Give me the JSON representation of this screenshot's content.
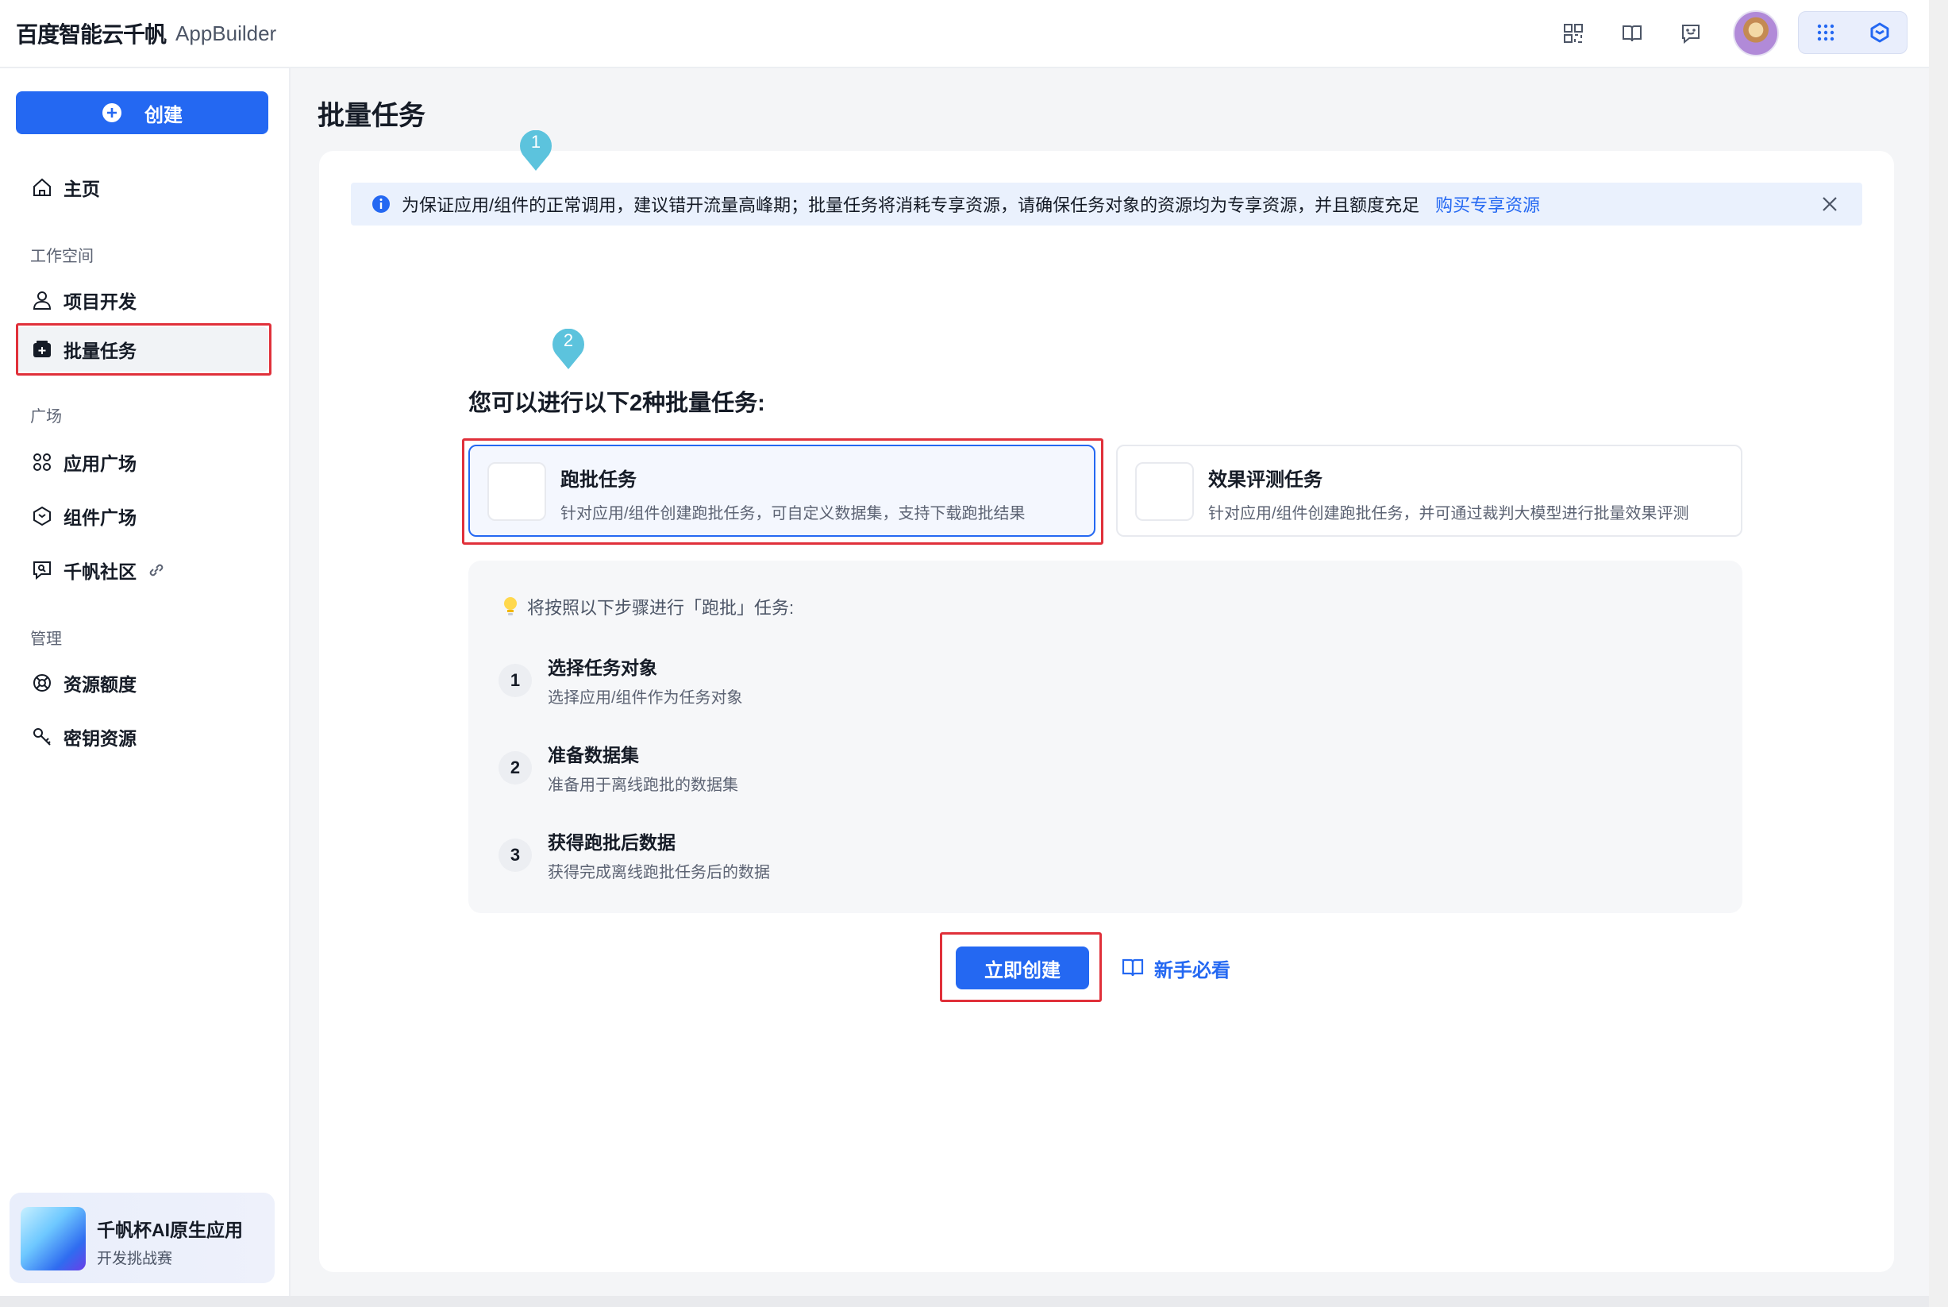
{
  "topbar": {
    "brand_name": "百度智能云千帆",
    "brand_app": "AppBuilder",
    "icons": [
      "apps-icon",
      "book-icon",
      "feedback-icon",
      "avatar",
      "grid-icon",
      "cube-icon"
    ]
  },
  "sidebar": {
    "create_label": "创建",
    "home": "主页",
    "section_workspace": "工作空间",
    "project_dev": "项目开发",
    "batch_tasks": "批量任务",
    "section_plaza": "广场",
    "app_plaza": "应用广场",
    "component_plaza": "组件广场",
    "community": "千帆社区",
    "section_manage": "管理",
    "quota": "资源额度",
    "keys": "密钥资源",
    "promo_title": "千帆杯AI原生应用",
    "promo_sub": "开发挑战赛"
  },
  "main": {
    "page_title": "批量任务",
    "alert_text": "为保证应用/组件的正常调用，建议错开流量高峰期；批量任务将消耗专享资源，请确保任务对象的资源均为专享资源，并且额度充足",
    "alert_link": "购买专享资源",
    "marker1": "1",
    "marker2": "2",
    "subheading": "您可以进行以下2种批量任务:",
    "types": [
      {
        "title": "跑批任务",
        "desc": "针对应用/组件创建跑批任务，可自定义数据集，支持下载跑批结果"
      },
      {
        "title": "效果评测任务",
        "desc": "针对应用/组件创建跑批任务，并可通过裁判大模型进行批量效果评测"
      }
    ],
    "steps_tip": "将按照以下步骤进行「跑批」任务:",
    "steps": [
      {
        "num": "1",
        "title": "选择任务对象",
        "desc": "选择应用/组件作为任务对象"
      },
      {
        "num": "2",
        "title": "准备数据集",
        "desc": "准备用于离线跑批的数据集"
      },
      {
        "num": "3",
        "title": "获得跑批后数据",
        "desc": "获得完成离线跑批任务后的数据"
      }
    ],
    "create_now": "立即创建",
    "guide": "新手必看"
  },
  "colors": {
    "primary": "#2468f2",
    "highlight_box": "#e0303a",
    "marker": "#5cc3dd"
  }
}
